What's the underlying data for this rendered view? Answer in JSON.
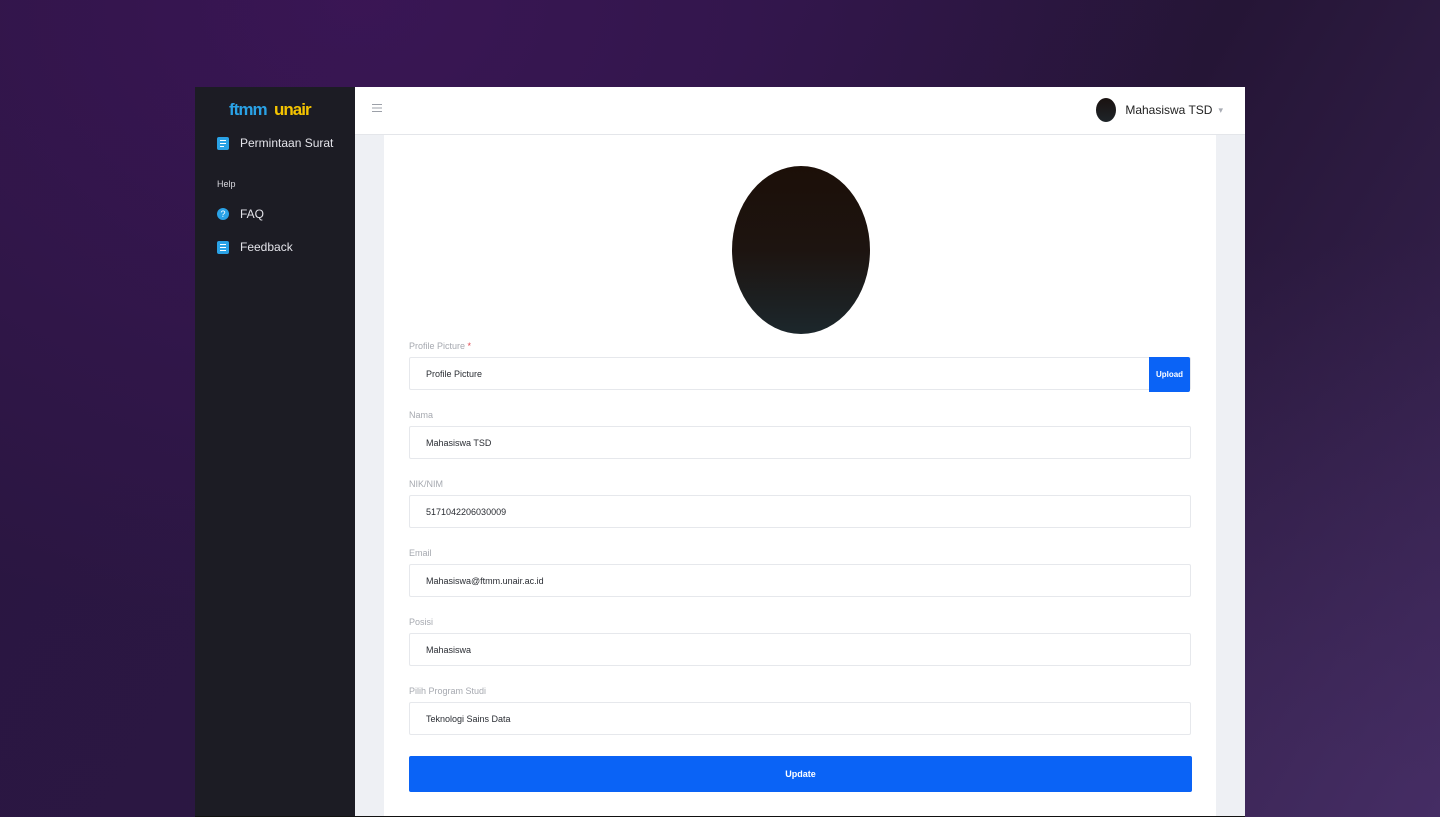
{
  "brand": {
    "logo_text": "ftmmunair"
  },
  "sidebar": {
    "items": [
      {
        "label": "Permintaan Surat",
        "icon": "document-icon"
      }
    ],
    "section_help": "Help",
    "help_items": [
      {
        "label": "FAQ",
        "icon": "question-circle-icon"
      },
      {
        "label": "Feedback",
        "icon": "list-icon"
      }
    ]
  },
  "topbar": {
    "menu_icon": "hamburger-icon",
    "user_name": "Mahasiswa TSD"
  },
  "form": {
    "profile_picture": {
      "label": "Profile Picture",
      "required_mark": "*",
      "value": "Profile Picture",
      "button": "Upload"
    },
    "nama": {
      "label": "Nama",
      "value": "Mahasiswa TSD"
    },
    "nik": {
      "label": "NIK/NIM",
      "value": "5171042206030009"
    },
    "email": {
      "label": "Email",
      "value": "Mahasiswa@ftmm.unair.ac.id"
    },
    "posisi": {
      "label": "Posisi",
      "value": "Mahasiswa"
    },
    "prodi": {
      "label": "Pilih Program Studi",
      "value": "Teknologi Sains Data"
    },
    "submit": "Update"
  },
  "colors": {
    "primary": "#0a63f6",
    "sidebar_bg": "#1c1c24",
    "logo_blue": "#2aa2e6",
    "logo_yellow": "#f5c400"
  }
}
